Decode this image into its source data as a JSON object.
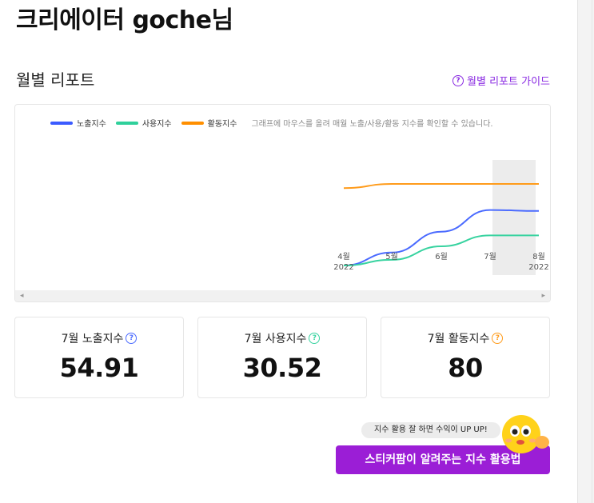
{
  "page": {
    "title": "크리에이터 goche님"
  },
  "monthly_report": {
    "section_title": "월별 리포트",
    "guide_link_label": "월별 리포트 가이드"
  },
  "chart_data": {
    "type": "line",
    "title": "",
    "x": [
      "4월\n2022",
      "5월",
      "6월",
      "7월",
      "8월\n2022"
    ],
    "series": [
      {
        "name": "노출지수",
        "color": "#4b6bff",
        "values": [
          1.5,
          14,
          34,
          54.91,
          54
        ]
      },
      {
        "name": "사용지수",
        "color": "#38d3a0",
        "values": [
          1.5,
          7,
          20,
          30.52,
          30.5
        ]
      },
      {
        "name": "활동지수",
        "color": "#ff9b1a",
        "values": [
          76,
          80,
          80,
          80,
          80
        ]
      }
    ],
    "ylim": [
      0,
      100
    ],
    "grid": false,
    "legend": "top",
    "hint": "그래프에 마우스를 올려 매월 노출/사용/활동 지수를 확인할 수 있습니다.",
    "x_tick_labels": [
      {
        "month": "4월",
        "year": "2022"
      },
      {
        "month": "5월",
        "year": ""
      },
      {
        "month": "6월",
        "year": ""
      },
      {
        "month": "7월",
        "year": ""
      },
      {
        "month": "8월",
        "year": "2022"
      }
    ]
  },
  "stats": [
    {
      "label": "7월 노출지수",
      "value": "54.91",
      "icon_color": "#4b6bff"
    },
    {
      "label": "7월 사용지수",
      "value": "30.52",
      "icon_color": "#38d3a0"
    },
    {
      "label": "7월 활동지수",
      "value": "80",
      "icon_color": "#ff9b1a"
    }
  ],
  "tip": {
    "bubble_text": "지수 활용 잘 하면 수익이 UP UP!",
    "cta_label": "스티커팜이 알려주는 지수 활용법"
  },
  "colors": {
    "accent": "#9b1ed6",
    "link": "#8a2be2"
  },
  "icons": {
    "help": "question-circle-icon",
    "mascot": "sticker-mascot-icon"
  }
}
